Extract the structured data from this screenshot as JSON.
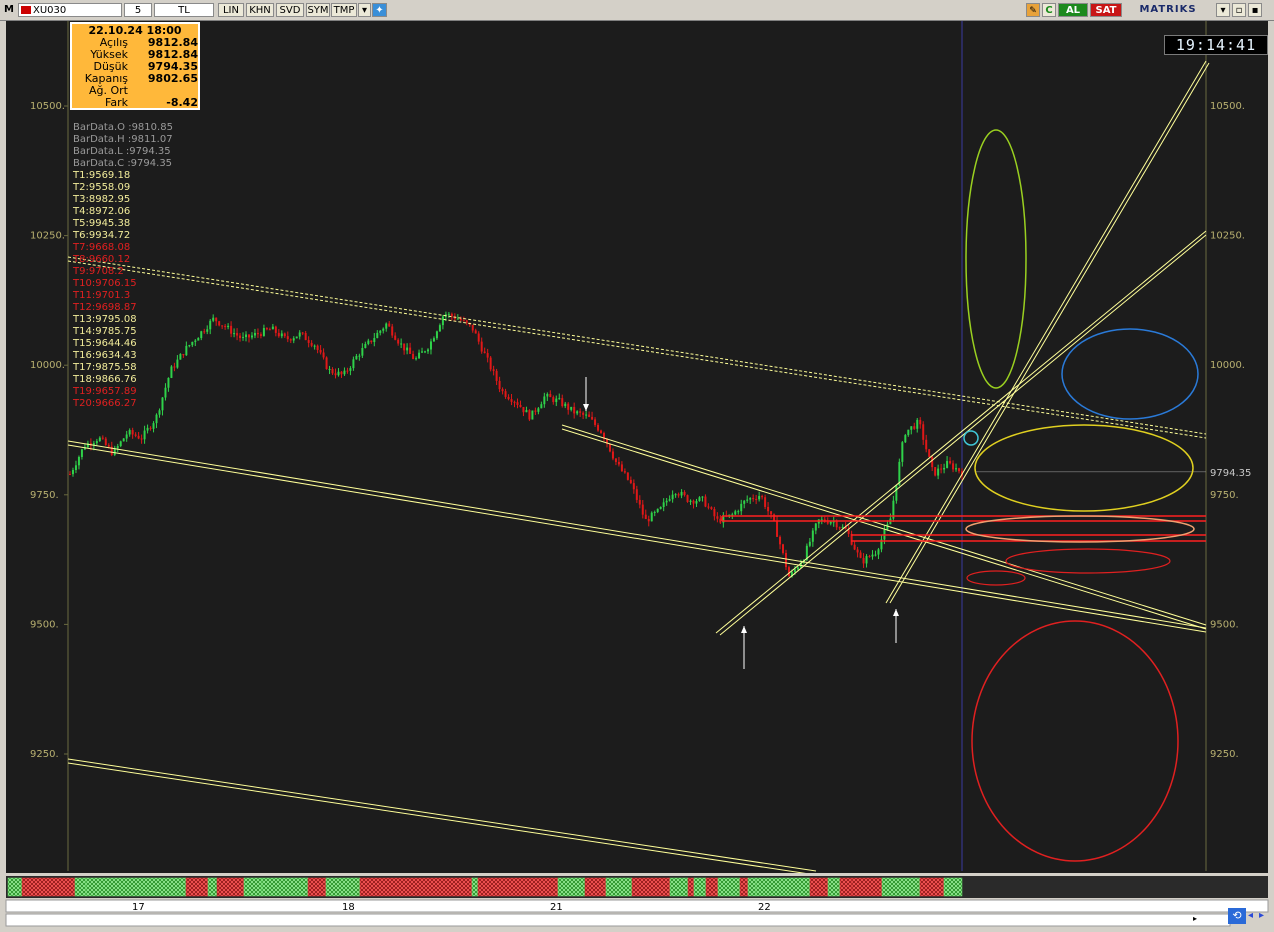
{
  "toolbar": {
    "app_letter": "M",
    "symbol": "XU030",
    "period": "5",
    "currency": "TL",
    "buttons": [
      "LIN",
      "KHN",
      "SVD",
      "SYM",
      "TMP"
    ],
    "buy_label": "AL",
    "sell_label": "SAT",
    "brand": "MATRIKS",
    "window_controls": [
      "minimize-icon",
      "restore-icon",
      "close-icon"
    ]
  },
  "clock": "19:14:41",
  "info_box": {
    "date": "22.10.24 18:00",
    "rows": [
      {
        "label": "Açılış",
        "value": "9812.84"
      },
      {
        "label": "Yüksek",
        "value": "9812.84"
      },
      {
        "label": "Düşük",
        "value": "9794.35"
      },
      {
        "label": "Kapanış",
        "value": "9802.65"
      },
      {
        "label": "Ağ. Ort",
        "value": ""
      },
      {
        "label": "Fark",
        "value": "-8.42"
      }
    ]
  },
  "data_list": [
    {
      "text": "BarData.O :9810.85",
      "color": "#9a9a9a"
    },
    {
      "text": "BarData.H :9811.07",
      "color": "#9a9a9a"
    },
    {
      "text": "BarData.L :9794.35",
      "color": "#9a9a9a"
    },
    {
      "text": "BarData.C :9794.35",
      "color": "#9a9a9a"
    },
    {
      "text": "T1:9569.18",
      "color": "#f2ec9a"
    },
    {
      "text": "T2:9558.09",
      "color": "#f2ec9a"
    },
    {
      "text": "T3:8982.95",
      "color": "#f2ec9a"
    },
    {
      "text": "T4:8972.06",
      "color": "#f2ec9a"
    },
    {
      "text": "T5:9945.38",
      "color": "#f2ec9a"
    },
    {
      "text": "T6:9934.72",
      "color": "#f2ec9a"
    },
    {
      "text": "T7:9668.08",
      "color": "#e02020"
    },
    {
      "text": "T8:9660.12",
      "color": "#e02020"
    },
    {
      "text": "T9:9708.2",
      "color": "#e02020"
    },
    {
      "text": "T10:9706.15",
      "color": "#e02020"
    },
    {
      "text": "T11:9701.3",
      "color": "#e02020"
    },
    {
      "text": "T12:9698.87",
      "color": "#e02020"
    },
    {
      "text": "T13:9795.08",
      "color": "#f2ec9a"
    },
    {
      "text": "T14:9785.75",
      "color": "#f2ec9a"
    },
    {
      "text": "T15:9644.46",
      "color": "#f2ec9a"
    },
    {
      "text": "T16:9634.43",
      "color": "#f2ec9a"
    },
    {
      "text": "T17:9875.58",
      "color": "#f2ec9a"
    },
    {
      "text": "T18:9866.76",
      "color": "#f2ec9a"
    },
    {
      "text": "T19:9657.89",
      "color": "#e02020"
    },
    {
      "text": "T20:9666.27",
      "color": "#e02020"
    }
  ],
  "colors": {
    "background": "#1c1c1c",
    "up": "#2fd24a",
    "down": "#e01818",
    "trendline": "#ffff99",
    "axis_text": "#b8b070",
    "info_bg": "#ffb83a"
  },
  "chart_data": {
    "type": "candlestick",
    "yticks": [
      "10500.",
      "10250.",
      "10000.",
      "9750.",
      "9500.",
      "9250."
    ],
    "ylim": [
      9050,
      10640
    ],
    "last_price_label": "9794.35",
    "x_labels": [
      "17",
      "18",
      "21",
      "22"
    ],
    "series": [
      {
        "values": [
          9790,
          9845,
          9860,
          9830,
          9870,
          9860,
          9900,
          9990,
          10030,
          10060,
          10090,
          10070,
          10050,
          10060,
          10070,
          10050,
          10060,
          10040,
          9990,
          9980,
          10020,
          10050,
          10080,
          10040,
          10010,
          10040,
          10100,
          10090,
          10070,
          10010,
          9950,
          9930,
          9900,
          9940,
          9930,
          9910,
          9900,
          9870,
          9810,
          9770,
          9700,
          9720,
          9760,
          9740,
          9740,
          9700,
          9710,
          9740,
          9750,
          9690,
          9590,
          9630,
          9700,
          9700,
          9680,
          9620,
          9640,
          9700,
          9870,
          9890,
          9790,
          9810,
          9794
        ]
      }
    ]
  }
}
